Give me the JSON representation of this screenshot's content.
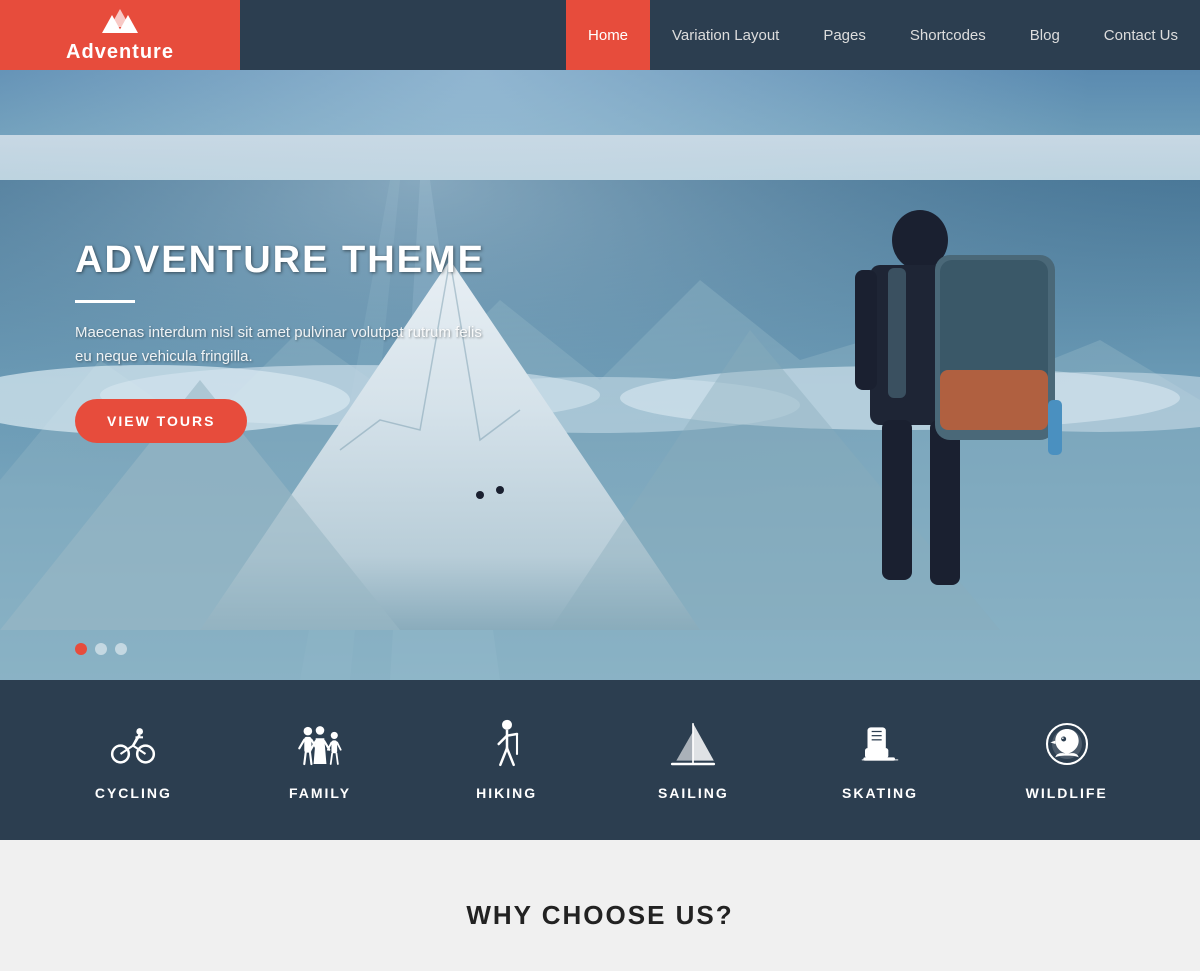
{
  "header": {
    "logo_icon": "▲",
    "logo_text": "Adventure",
    "nav_items": [
      {
        "label": "Home",
        "active": true
      },
      {
        "label": "Variation Layout",
        "active": false
      },
      {
        "label": "Pages",
        "active": false
      },
      {
        "label": "Shortcodes",
        "active": false
      },
      {
        "label": "Blog",
        "active": false
      },
      {
        "label": "Contact Us",
        "active": false
      }
    ]
  },
  "hero": {
    "title": "ADVENTURE THEME",
    "description": "Maecenas interdum nisl sit amet pulvinar volutpat rutrum felis eu neque vehicula fringilla.",
    "button_label": "VIEW TOURS",
    "dots": [
      {
        "active": true
      },
      {
        "active": false
      },
      {
        "active": false
      }
    ]
  },
  "categories": [
    {
      "label": "CYCLING",
      "icon": "cycling"
    },
    {
      "label": "FAMILY",
      "icon": "family"
    },
    {
      "label": "HIKING",
      "icon": "hiking"
    },
    {
      "label": "SAILING",
      "icon": "sailing"
    },
    {
      "label": "SKATING",
      "icon": "skating"
    },
    {
      "label": "WILDLIFE",
      "icon": "wildlife"
    }
  ],
  "why_section": {
    "title": "WHY CHOOSE US?"
  },
  "colors": {
    "accent": "#e74c3c",
    "dark": "#2c3e50",
    "nav_active_bg": "#e74c3c"
  }
}
